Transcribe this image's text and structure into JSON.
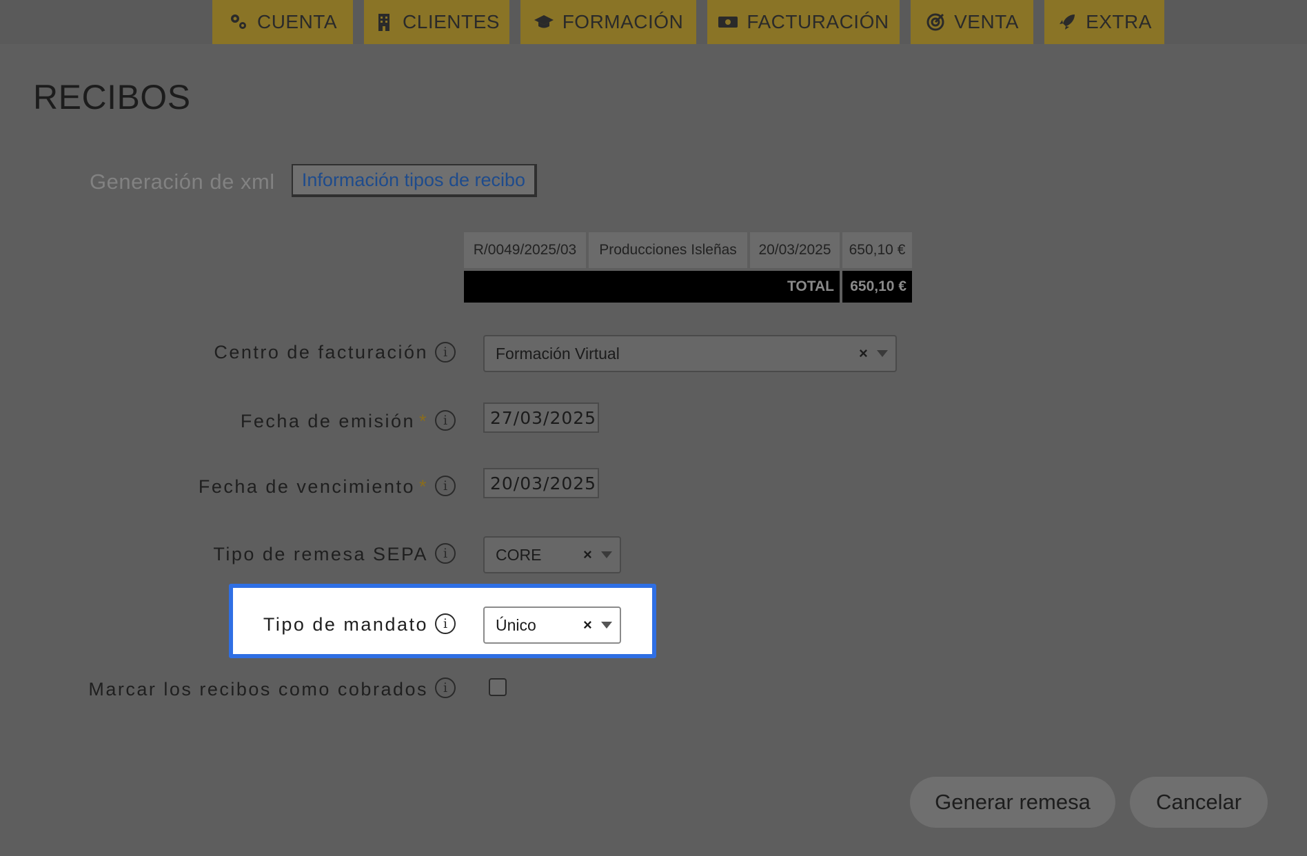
{
  "nav": {
    "tabs": [
      {
        "label": "CUENTA",
        "icon": "gears-icon"
      },
      {
        "label": "CLIENTES",
        "icon": "building-icon"
      },
      {
        "label": "FORMACIÓN",
        "icon": "graduation-cap-icon"
      },
      {
        "label": "FACTURACIÓN",
        "icon": "money-bill-icon"
      },
      {
        "label": "VENTA",
        "icon": "target-icon"
      },
      {
        "label": "EXTRA",
        "icon": "rocket-icon"
      }
    ]
  },
  "page": {
    "title": "RECIBOS",
    "tabs": {
      "xml": "Generación de xml",
      "info": "Información tipos de recibo"
    }
  },
  "receipts": {
    "rows": [
      {
        "number": "R/0049/2025/03",
        "client": "Producciones Isleñas",
        "date": "20/03/2025",
        "amount": "650,10 €"
      }
    ],
    "total_label": "TOTAL",
    "total_amount": "650,10 €"
  },
  "form": {
    "centro": {
      "label": "Centro de facturación",
      "value": "Formación Virtual"
    },
    "emision": {
      "label": "Fecha de emisión",
      "required_mark": "*",
      "value": "27/03/2025"
    },
    "vencimiento": {
      "label": "Fecha de vencimiento",
      "required_mark": "*",
      "value": "20/03/2025"
    },
    "remesa": {
      "label": "Tipo de remesa SEPA",
      "value": "CORE"
    },
    "mandato": {
      "label": "Tipo de mandato",
      "value": "Único"
    },
    "cobrados": {
      "label": "Marcar los recibos como cobrados",
      "checked": false
    }
  },
  "info_glyph": "i",
  "clear_glyph": "×",
  "actions": {
    "generate": "Generar remesa",
    "cancel": "Cancelar"
  },
  "colors": {
    "nav_tab": "#8a7426",
    "highlight_border": "#2f6fe4",
    "link": "#1e4b8c"
  }
}
